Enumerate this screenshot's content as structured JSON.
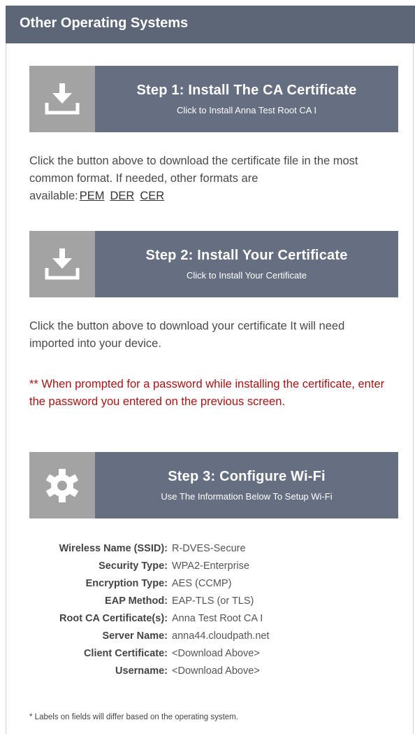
{
  "header": {
    "title": "Other Operating Systems"
  },
  "step1": {
    "title": "Step 1: Install The CA Certificate",
    "subtitle": "Click to Install Anna Test Root CA I",
    "icon": "download-icon"
  },
  "step1_desc": {
    "text": "Click the button above to download the certificate file in the most common format. If needed, other formats are available:",
    "formats": [
      "PEM",
      "DER",
      "CER"
    ]
  },
  "step2": {
    "title": "Step 2: Install Your Certificate",
    "subtitle": "Click to Install Your Certificate",
    "icon": "download-icon"
  },
  "step2_desc": {
    "text": "Click the button above to download your certificate It will need imported into your device."
  },
  "warning": {
    "text": "** When prompted for a password while installing the certificate, enter the password you entered on the previous screen."
  },
  "step3": {
    "title": "Step 3: Configure Wi-Fi",
    "subtitle": "Use The Information Below To Setup Wi-Fi",
    "icon": "gear-icon"
  },
  "wifi_info": [
    {
      "label": "Wireless Name (SSID):",
      "value": "R-DVES-Secure"
    },
    {
      "label": "Security Type:",
      "value": "WPA2-Enterprise"
    },
    {
      "label": "Encryption Type:",
      "value": "AES (CCMP)"
    },
    {
      "label": "EAP Method:",
      "value": "EAP-TLS (or TLS)"
    },
    {
      "label": "Root CA Certificate(s):",
      "value": "Anna Test Root CA I"
    },
    {
      "label": "Server Name:",
      "value": "anna44.cloudpath.net"
    },
    {
      "label": "Client Certificate:",
      "value": "<Download Above>"
    },
    {
      "label": "Username:",
      "value": "<Download Above>"
    }
  ],
  "footnote": "* Labels on fields will differ based on the operating system.",
  "colors": {
    "header_bg": "#5c6677",
    "button_bg": "#666f82",
    "icon_bg": "#a3a3a3",
    "warning": "#a31515"
  }
}
